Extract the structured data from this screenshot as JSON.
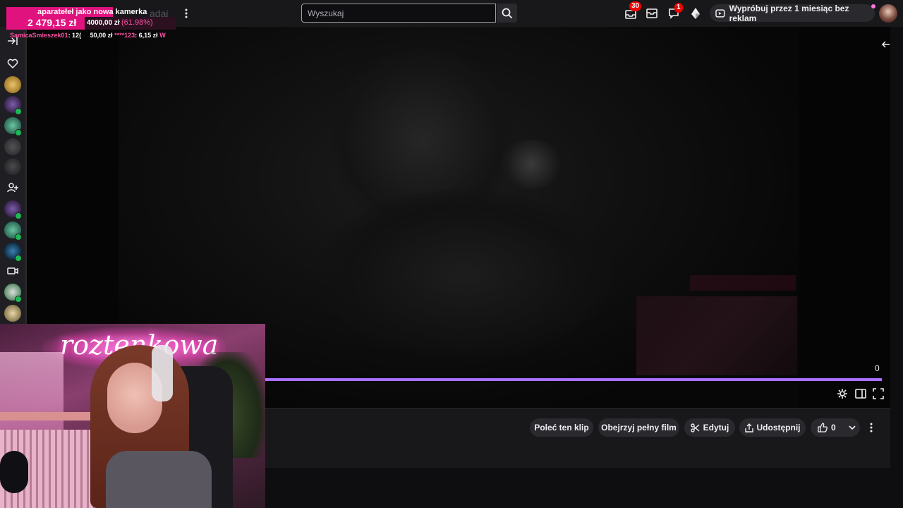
{
  "topbar": {
    "search_placeholder": "Wyszukaj",
    "notifications_count": "30",
    "whispers_count": "1",
    "prime_label": "Wypróbuj przez 1 miesiąc bez reklam",
    "partial_label": "ądaj"
  },
  "overlay": {
    "goal_title": "aparatełeł jako nowa kamerka",
    "goal_current": "2 479,15 zł",
    "goal_target": "4000,00 zł",
    "goal_percent": "(61.98%)",
    "ticker": [
      {
        "name": "SamicaSmieszek01",
        "amount": ": 12("
      },
      {
        "name": "",
        "amount": "50,00 zł"
      },
      {
        "name": "****123",
        "amount": ": 6,15 zł"
      },
      {
        "name": "W",
        "amount": ""
      }
    ],
    "neon_sign": "roztenkowa"
  },
  "player": {
    "time": "0"
  },
  "clip_actions": {
    "recommend": "Poleć ten klip",
    "watch_full": "Obejrzyj pełny film",
    "edit": "Edytuj",
    "share": "Udostępnij",
    "likes": "0"
  },
  "colors": {
    "accent": "#a970ff",
    "badge": "#eb0400",
    "overlay_pink": "#e0127e"
  }
}
